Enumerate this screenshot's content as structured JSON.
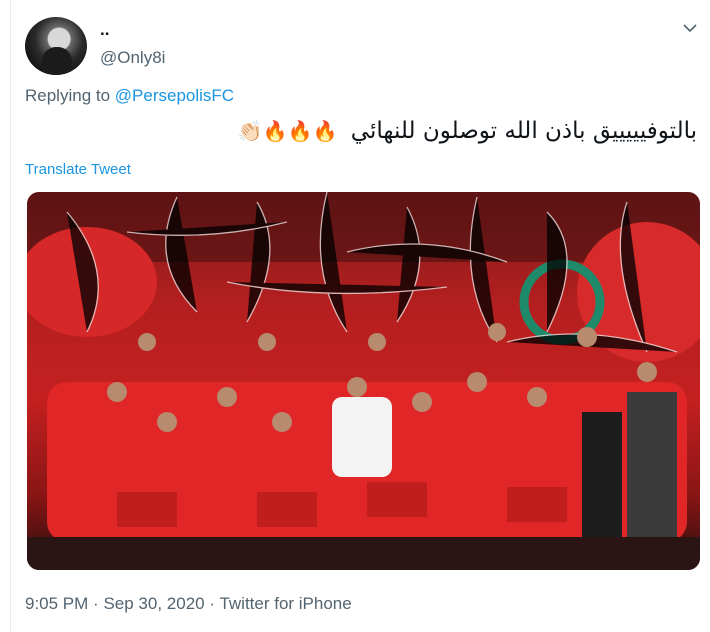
{
  "tweet": {
    "display_name": "..",
    "handle": "@Only8i",
    "replying_prefix": "Replying to",
    "replying_to": "@PersepolisFC",
    "text": "بالتوفيييييق باذن الله توصلون للنهائي",
    "emojis": "🔥🔥🔥👏🏻",
    "translate_label": "Translate Tweet",
    "time": "9:05 PM",
    "separator": "·",
    "date": "Sep 30, 2020",
    "source": "Twitter for iPhone",
    "photo_icon": "team-celebration-photo"
  },
  "colors": {
    "link": "#1b95e0",
    "secondary": "#536471",
    "text": "#0f1419",
    "photo_red": "#c42020"
  }
}
